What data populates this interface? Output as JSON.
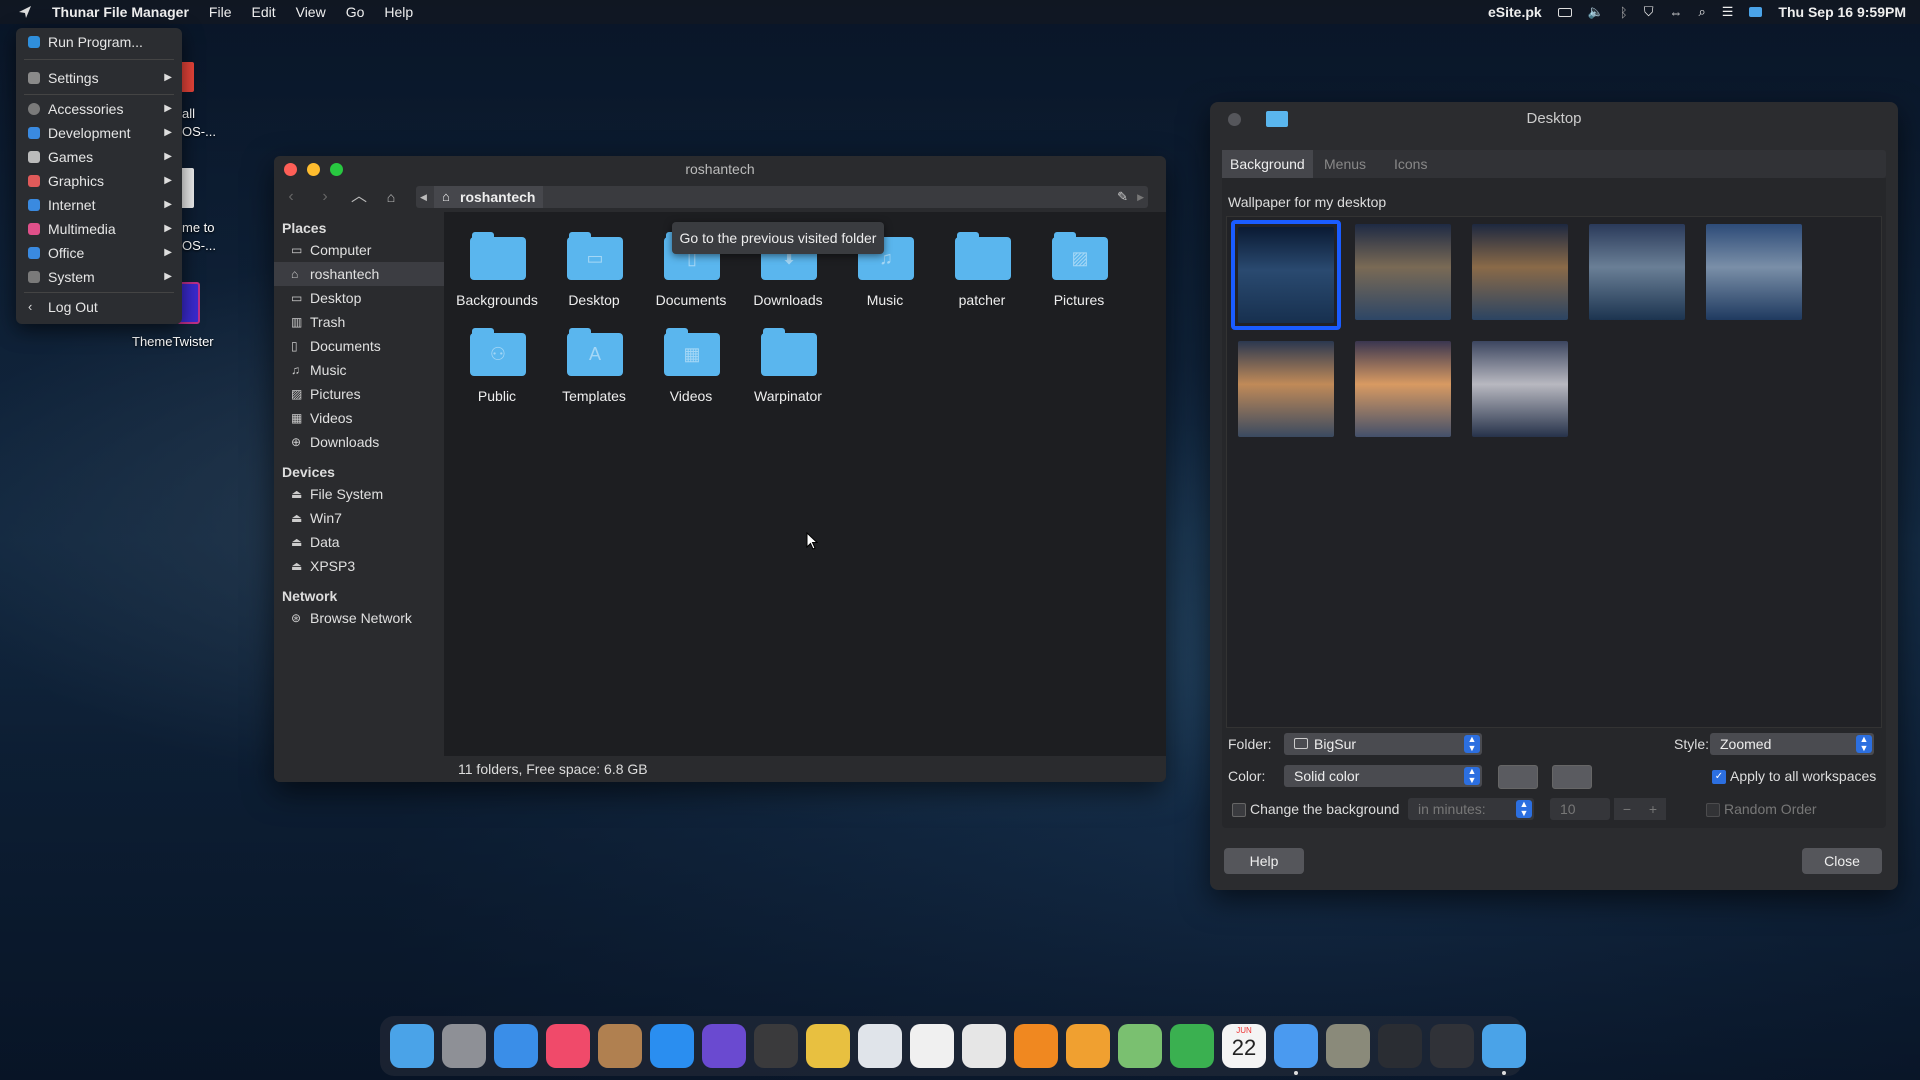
{
  "menubar": {
    "app_name": "Thunar File Manager",
    "menus": [
      "File",
      "Edit",
      "View",
      "Go",
      "Help"
    ],
    "site": "eSite.pk",
    "datetime": "Thu Sep 16  9:59PM"
  },
  "app_menu": {
    "items": [
      {
        "label": "Run Program...",
        "color": "#2f8fdc",
        "submenu": false
      },
      {
        "label": "Settings",
        "color": "#8a8a8a",
        "submenu": true
      },
      {
        "label": "Accessories",
        "color": "#7a7a7a",
        "submenu": true
      },
      {
        "label": "Development",
        "color": "#3a8ae0",
        "submenu": true
      },
      {
        "label": "Games",
        "color": "#bbbbbb",
        "submenu": true
      },
      {
        "label": "Graphics",
        "color": "#e05a5a",
        "submenu": true
      },
      {
        "label": "Internet",
        "color": "#3a8ae0",
        "submenu": true
      },
      {
        "label": "Multimedia",
        "color": "#e0508a",
        "submenu": true
      },
      {
        "label": "Office",
        "color": "#3a8ae0",
        "submenu": true
      },
      {
        "label": "System",
        "color": "#7a7a7a",
        "submenu": true
      }
    ],
    "logout": "Log Out"
  },
  "desktop_icons": {
    "partial_1a": "all",
    "partial_1b": "OS-...",
    "partial_2a": "me to",
    "partial_2b": "OS-...",
    "theme": "ThemeTwister"
  },
  "file_manager": {
    "title": "roshantech",
    "path_crumb": "roshantech",
    "places_header": "Places",
    "places": [
      {
        "label": "Computer",
        "icon": "computer-icon",
        "selected": false
      },
      {
        "label": "roshantech",
        "icon": "home-icon",
        "selected": true
      },
      {
        "label": "Desktop",
        "icon": "desktop-icon",
        "selected": false
      },
      {
        "label": "Trash",
        "icon": "trash-icon",
        "selected": false
      },
      {
        "label": "Documents",
        "icon": "documents-icon",
        "selected": false
      },
      {
        "label": "Music",
        "icon": "music-icon",
        "selected": false
      },
      {
        "label": "Pictures",
        "icon": "pictures-icon",
        "selected": false
      },
      {
        "label": "Videos",
        "icon": "videos-icon",
        "selected": false
      },
      {
        "label": "Downloads",
        "icon": "downloads-icon",
        "selected": false
      }
    ],
    "devices_header": "Devices",
    "devices": [
      "File System",
      "Win7",
      "Data",
      "XPSP3"
    ],
    "network_header": "Network",
    "network": [
      "Browse Network"
    ],
    "folders": [
      {
        "label": "Backgrounds",
        "glyph": ""
      },
      {
        "label": "Desktop",
        "glyph": "▭"
      },
      {
        "label": "Documents",
        "glyph": "▯"
      },
      {
        "label": "Downloads",
        "glyph": "⬇"
      },
      {
        "label": "Music",
        "glyph": "♫"
      },
      {
        "label": "patcher",
        "glyph": ""
      },
      {
        "label": "Pictures",
        "glyph": "▨"
      },
      {
        "label": "Public",
        "glyph": "⚇"
      },
      {
        "label": "Templates",
        "glyph": "A"
      },
      {
        "label": "Videos",
        "glyph": "▦"
      },
      {
        "label": "Warpinator",
        "glyph": ""
      }
    ],
    "tooltip": "Go to the previous visited folder",
    "status": "11 folders, Free space: 6.8 GB"
  },
  "desktop_settings": {
    "title": "Desktop",
    "tabs": [
      "Background",
      "Menus",
      "Icons"
    ],
    "active_tab": "Background",
    "wallpaper_label": "Wallpaper for my desktop",
    "wallpapers": [
      {
        "c1": "#0a1a33",
        "c2": "#2a4a70",
        "c3": "#17304f"
      },
      {
        "c1": "#1e2a44",
        "c2": "#7a6a55",
        "c3": "#2d4666"
      },
      {
        "c1": "#1d2840",
        "c2": "#8a6a48",
        "c3": "#2b4462"
      },
      {
        "c1": "#2a3a5a",
        "c2": "#6a7f96",
        "c3": "#1c3450"
      },
      {
        "c1": "#2d4b78",
        "c2": "#7a8fa8",
        "c3": "#1f3a60"
      },
      {
        "c1": "#2b3850",
        "c2": "#c08a58",
        "c3": "#3a4a60"
      },
      {
        "c1": "#3a3650",
        "c2": "#d89a62",
        "c3": "#43506a"
      },
      {
        "c1": "#3c4660",
        "c2": "#b8b8c0",
        "c3": "#26324a"
      }
    ],
    "folder_label": "Folder:",
    "folder_value": "BigSur",
    "style_label": "Style:",
    "style_value": "Zoomed",
    "color_label": "Color:",
    "color_value": "Solid color",
    "apply_all_label": "Apply to all workspaces",
    "apply_all_checked": true,
    "change_bg_label": "Change the background",
    "change_bg_checked": false,
    "interval_unit": "in minutes:",
    "interval_value": "10",
    "random_label": "Random Order",
    "help_button": "Help",
    "close_button": "Close"
  },
  "dock": {
    "apps": [
      {
        "name": "files-icon",
        "color": "#4aa3e8"
      },
      {
        "name": "system-preferences-icon",
        "color": "#8e9096"
      },
      {
        "name": "mail-icon",
        "color": "#3a8ee8"
      },
      {
        "name": "music-icon",
        "color": "#f04a6a"
      },
      {
        "name": "contacts-icon",
        "color": "#b08050"
      },
      {
        "name": "app-store-icon",
        "color": "#2a8ef0"
      },
      {
        "name": "screenshot-icon",
        "color": "#6a4ad0"
      },
      {
        "name": "calculator-icon",
        "color": "#3a3a3c"
      },
      {
        "name": "chrome-icon",
        "color": "#e8c040"
      },
      {
        "name": "launchpad-icon",
        "color": "#e0e4ea"
      },
      {
        "name": "photos-icon",
        "color": "#f0f0f0"
      },
      {
        "name": "text-editor-icon",
        "color": "#e6e6e6"
      },
      {
        "name": "vlc-icon",
        "color": "#f08820"
      },
      {
        "name": "preview-icon",
        "color": "#f0a030"
      },
      {
        "name": "maps-icon",
        "color": "#7ac070"
      },
      {
        "name": "numbers-icon",
        "color": "#3ab050"
      },
      {
        "name": "calendar-icon",
        "color": "#f4f4f4"
      },
      {
        "name": "finder-icon",
        "color": "#4a9af0"
      },
      {
        "name": "system-tool-icon",
        "color": "#8a8a7a"
      },
      {
        "name": "activity-monitor-icon",
        "color": "#2a2d33"
      },
      {
        "name": "back-icon",
        "color": "#303238"
      },
      {
        "name": "desktop-folder-icon",
        "color": "#4aa3e8"
      }
    ],
    "calendar_month": "JUN",
    "calendar_day": "22"
  }
}
